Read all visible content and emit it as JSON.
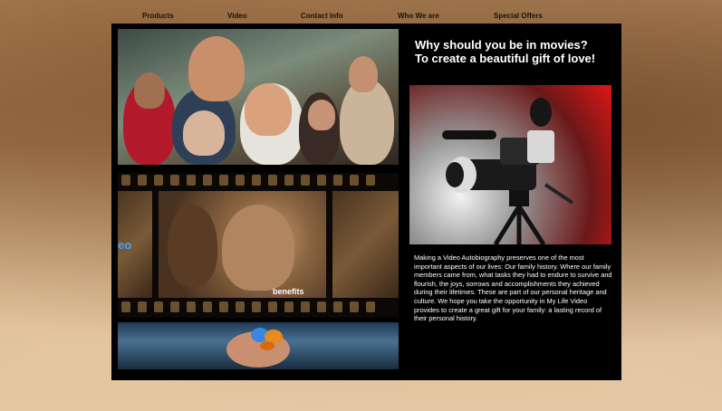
{
  "nav": {
    "items": [
      {
        "label": "Products"
      },
      {
        "label": "Video"
      },
      {
        "label": "Contact Info"
      },
      {
        "label": "Who We are"
      },
      {
        "label": "Special Offers"
      }
    ]
  },
  "main": {
    "headline_line1": "Why should you be in movies?",
    "headline_line2": "To create a beautiful gift of love!",
    "film_label": "benefits",
    "film_left_snippet": "eo",
    "body": "Making a Video Autobiography preserves one of the most important aspects of our lives: Our family history. Where our family members came from, what tasks they had to endure to survive and flourish, the joys, sorrows and accomplishments they achieved during their lifetimes. These are part of our personal heritage and culture. We hope you take the opportunity in My Life Video provides to create a great gift for your family: a lasting record of their personal history."
  },
  "colors": {
    "panel": "#000000",
    "nav_text": "#1a120a",
    "accent_red": "#e01616"
  },
  "icons": [
    "video-camera-icon",
    "butterfly-icon"
  ]
}
